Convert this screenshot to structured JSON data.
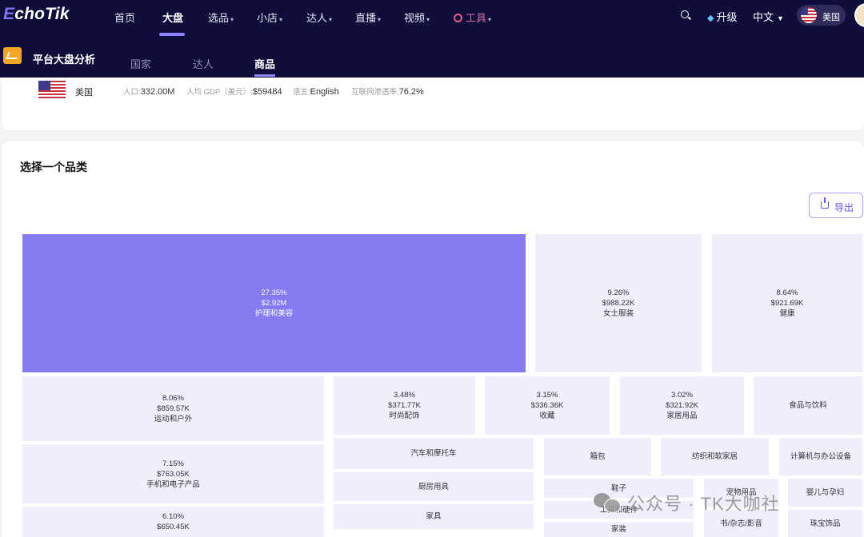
{
  "nav": {
    "logo": {
      "first": "E",
      "rest": "choTik"
    },
    "items": [
      {
        "label": "首页"
      },
      {
        "label": "大盘"
      },
      {
        "label": "选品"
      },
      {
        "label": "小店"
      },
      {
        "label": "达人"
      },
      {
        "label": "直播"
      },
      {
        "label": "视频"
      },
      {
        "label": "工具"
      }
    ],
    "upgrade": "升级",
    "language": "中文",
    "region": "美国"
  },
  "subnav": {
    "title": "平台大盘分析",
    "tabs": [
      {
        "label": "国家"
      },
      {
        "label": "达人"
      },
      {
        "label": "商品"
      }
    ]
  },
  "country": {
    "name": "美国",
    "population_label": "人口:",
    "population": "332.00M",
    "gdp_label": "人均 GDP（美元）:",
    "gdp": "$59484",
    "language_label": "语言:",
    "language": "English",
    "internet_label": "互联网渗透率:",
    "internet": "76.2%"
  },
  "category": {
    "title": "选择一个品类",
    "export_label": "导出"
  },
  "chart_data": {
    "type": "treemap",
    "items": [
      {
        "name": "护理和美容",
        "percent": "27.35%",
        "value": "$2.92M"
      },
      {
        "name": "女士服装",
        "percent": "9.26%",
        "value": "$988.22K"
      },
      {
        "name": "健康",
        "percent": "8.64%",
        "value": "$921.69K"
      },
      {
        "name": "运动和户外",
        "percent": "8.06%",
        "value": "$859.57K"
      },
      {
        "name": "手机和电子产品",
        "percent": "7.15%",
        "value": "$763.05K"
      },
      {
        "name": "",
        "percent": "6.10%",
        "value": "$650.45K"
      },
      {
        "name": "时尚配饰",
        "percent": "3.48%",
        "value": "$371.77K"
      },
      {
        "name": "收藏",
        "percent": "3.15%",
        "value": "$336.36K"
      },
      {
        "name": "家居用品",
        "percent": "3.02%",
        "value": "$321.92K"
      },
      {
        "name": "食品与饮料",
        "percent": "",
        "value": ""
      },
      {
        "name": "汽车和摩托车",
        "percent": "",
        "value": ""
      },
      {
        "name": "厨房用具",
        "percent": "",
        "value": ""
      },
      {
        "name": "家具",
        "percent": "",
        "value": ""
      },
      {
        "name": "箱包",
        "percent": "",
        "value": ""
      },
      {
        "name": "纺织和软家居",
        "percent": "",
        "value": ""
      },
      {
        "name": "计算机与办公设备",
        "percent": "",
        "value": ""
      },
      {
        "name": "鞋子",
        "percent": "",
        "value": ""
      },
      {
        "name": "宠物用品",
        "percent": "",
        "value": ""
      },
      {
        "name": "婴儿与孕妇",
        "percent": "",
        "value": ""
      },
      {
        "name": "工具和硬件",
        "percent": "",
        "value": ""
      },
      {
        "name": "书/杂志/影音",
        "percent": "",
        "value": ""
      },
      {
        "name": "珠宝饰品",
        "percent": "",
        "value": ""
      },
      {
        "name": "家装",
        "percent": "",
        "value": ""
      }
    ]
  },
  "watermark": "公众号 · TK大咖社",
  "colors": {
    "nav_bg": "#0f0d3a",
    "accent": "#837bef",
    "tile_bg": "#efeefc"
  }
}
